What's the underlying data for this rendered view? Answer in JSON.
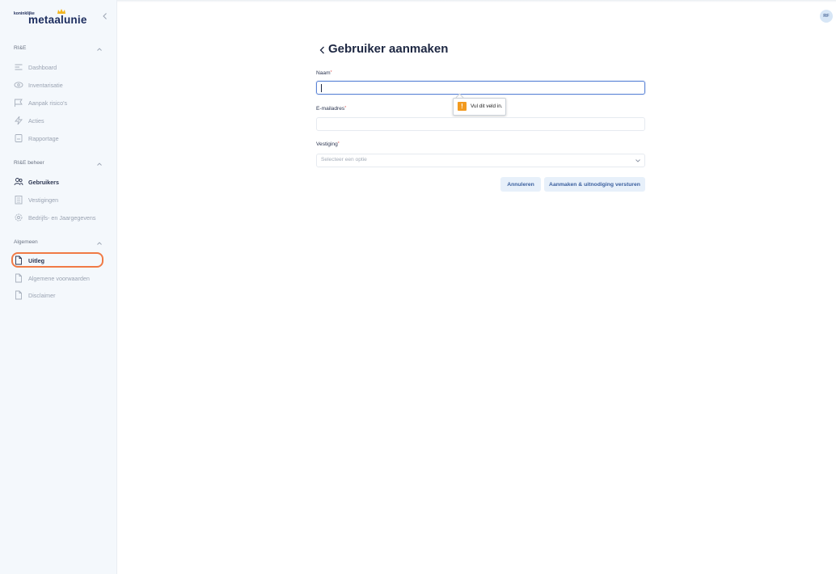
{
  "logo": {
    "prefix": "koninklijke",
    "name": "metaalunie"
  },
  "user": {
    "initials": "RF"
  },
  "sidebar": {
    "sections": [
      {
        "title": "RI&E",
        "items": [
          {
            "label": "Dashboard",
            "icon": "list-icon"
          },
          {
            "label": "Inventarisatie",
            "icon": "eye-icon"
          },
          {
            "label": "Aanpak risico's",
            "icon": "flag-icon"
          },
          {
            "label": "Acties",
            "icon": "lightning-icon"
          },
          {
            "label": "Rapportage",
            "icon": "report-icon"
          }
        ]
      },
      {
        "title": "RI&E beheer",
        "items": [
          {
            "label": "Gebruikers",
            "icon": "users-icon"
          },
          {
            "label": "Vestigingen",
            "icon": "building-icon"
          },
          {
            "label": "Bedrijfs- en Jaargegevens",
            "icon": "gear-icon"
          }
        ]
      },
      {
        "title": "Algemeen",
        "items": [
          {
            "label": "Uitleg",
            "icon": "document-icon"
          },
          {
            "label": "Algemene voorwaarden",
            "icon": "document-icon"
          },
          {
            "label": "Disclaimer",
            "icon": "document-icon"
          }
        ]
      }
    ]
  },
  "page": {
    "title": "Gebruiker aanmaken"
  },
  "form": {
    "name": {
      "label": "Naam",
      "required_mark": "*",
      "value": ""
    },
    "email": {
      "label": "E-mailadres",
      "required_mark": "*",
      "value": ""
    },
    "branch": {
      "label": "Vestiging",
      "required_mark": "*",
      "placeholder": "Selecteer een optie"
    },
    "validation_tooltip": "Vul dit veld in.",
    "cancel_label": "Annuleren",
    "submit_label": "Aanmaken & uitnodiging versturen"
  },
  "colors": {
    "accent": "#5b84d6",
    "highlight": "#f07a45",
    "warning": "#f29a1f",
    "brand": "#1b2c5e"
  }
}
